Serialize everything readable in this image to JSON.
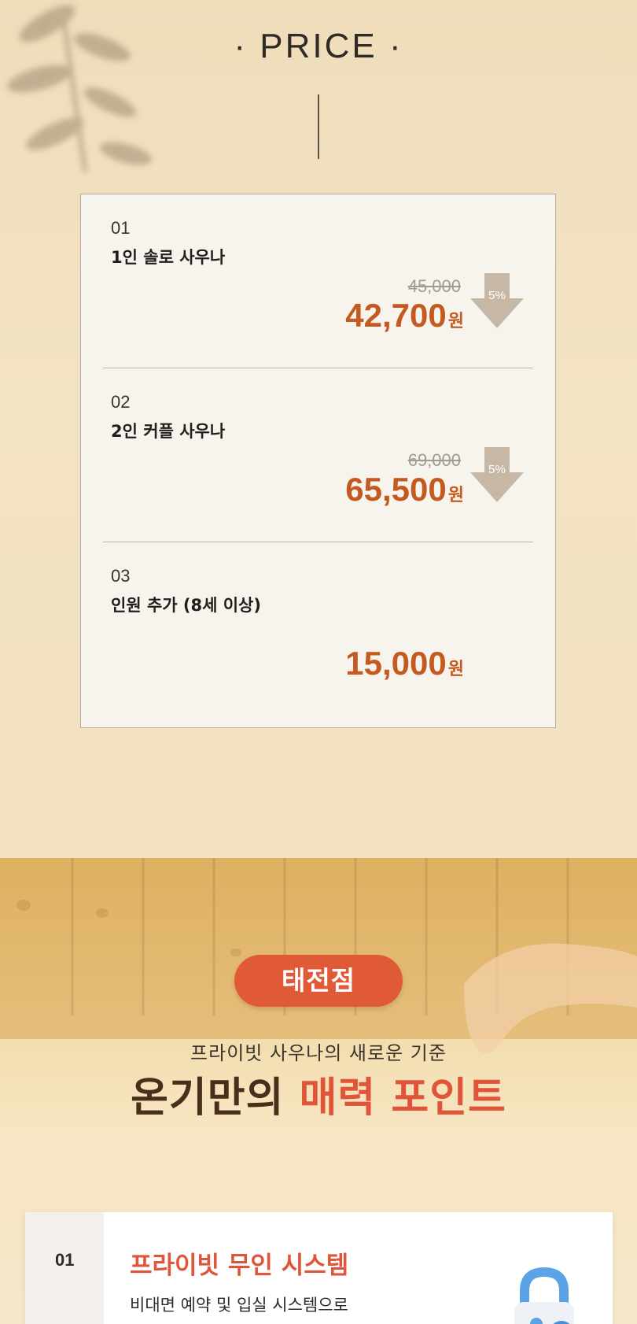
{
  "price_section": {
    "title": "· PRICE ·",
    "items": [
      {
        "number": "01",
        "name": "1인 솔로 사우나",
        "original_price": "45,000",
        "price": "42,700",
        "unit": "원",
        "discount": "5%"
      },
      {
        "number": "02",
        "name": "2인 커플 사우나",
        "original_price": "69,000",
        "price": "65,500",
        "unit": "원",
        "discount": "5%"
      },
      {
        "number": "03",
        "name": "인원 추가 (8세 이상)",
        "price": "15,000",
        "unit": "원"
      }
    ]
  },
  "branch_section": {
    "tag": "태전점",
    "subtitle": "프라이빗 사우나의 새로운 기준",
    "headline_main": "온기만의",
    "headline_accent": "매력 포인트",
    "feature": {
      "number": "01",
      "title": "프라이빗 무인 시스템",
      "description": "비대면 예약 및 입실 시스템으로",
      "icon": "lock-icon"
    }
  },
  "colors": {
    "accent": "#e05a38",
    "price": "#c45a1f",
    "background": "#f0e1c4"
  }
}
